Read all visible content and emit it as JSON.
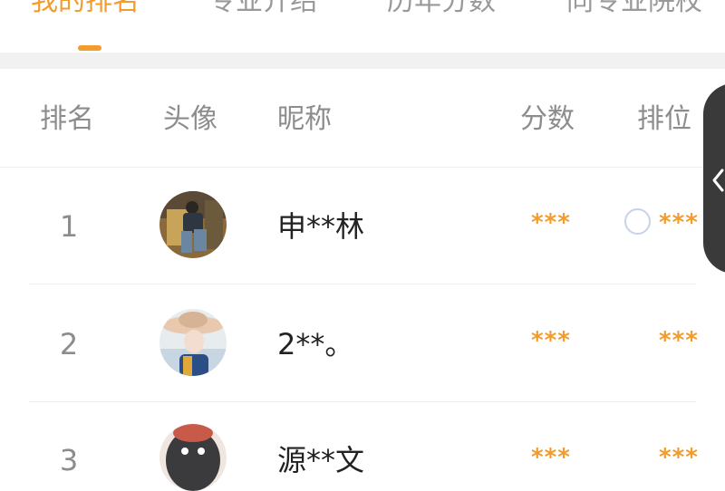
{
  "tabs": [
    {
      "label": "我的排名",
      "active": true
    },
    {
      "label": "专业介绍",
      "active": false
    },
    {
      "label": "历年分数",
      "active": false
    },
    {
      "label": "同专业院校",
      "active": false
    }
  ],
  "table": {
    "columns": [
      "排名",
      "头像",
      "昵称",
      "分数",
      "排位"
    ],
    "rows": [
      {
        "rank": "1",
        "nickname": "申**林",
        "score": "***",
        "position": "***"
      },
      {
        "rank": "2",
        "nickname": "2**。",
        "score": "***",
        "position": "***"
      },
      {
        "rank": "3",
        "nickname": "源**文",
        "score": "***",
        "position": "***"
      }
    ]
  },
  "colors": {
    "accent": "#f39c2e",
    "muted": "#8c8c8c",
    "text": "#222222"
  },
  "icons": {
    "side_handle": "chevron-left-icon"
  }
}
